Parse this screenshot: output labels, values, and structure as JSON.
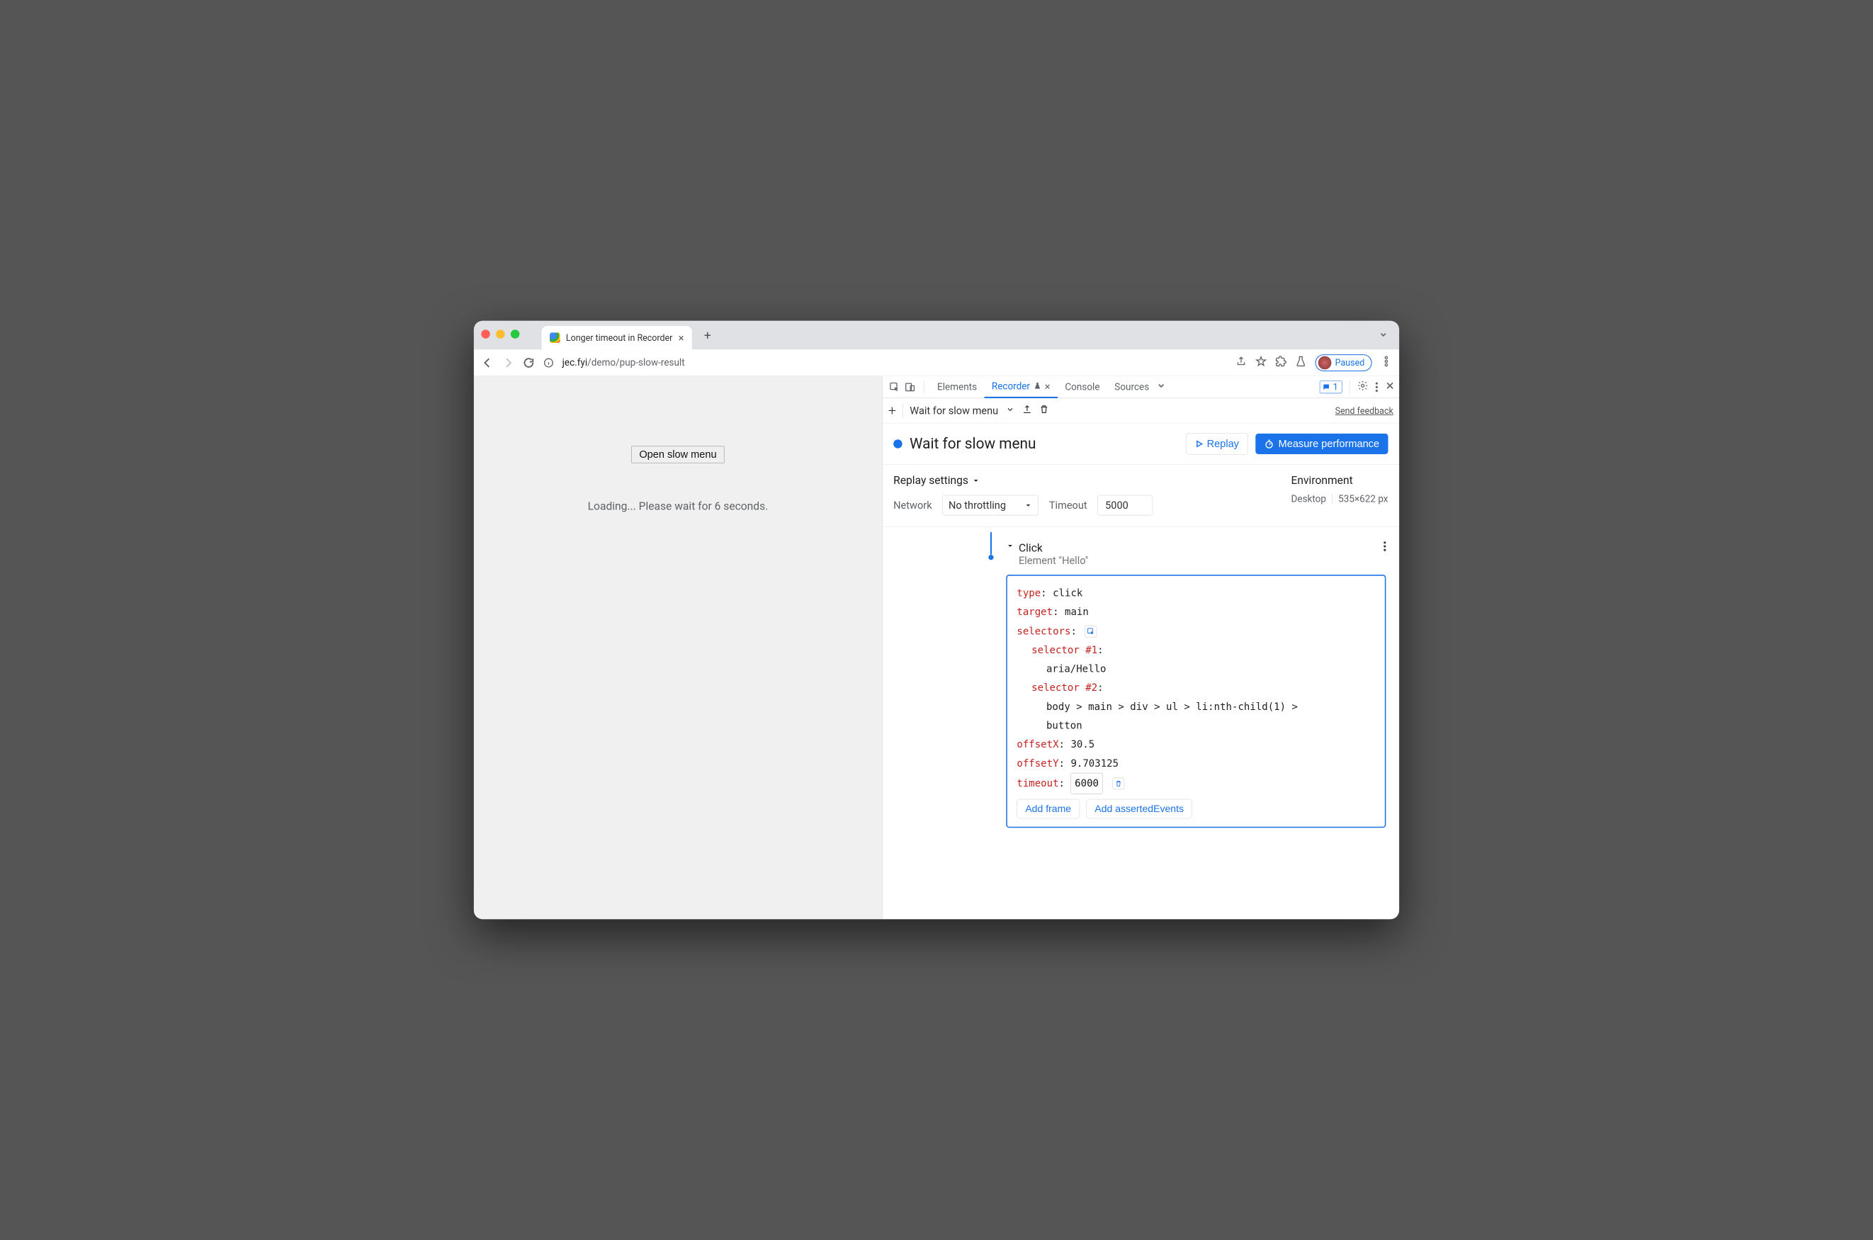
{
  "browser": {
    "tab_title": "Longer timeout in Recorder",
    "url_host": "jec.fyi",
    "url_path": "/demo/pup-slow-result",
    "paused_label": "Paused"
  },
  "page": {
    "button_label": "Open slow menu",
    "loading_text": "Loading... Please wait for 6 seconds."
  },
  "devtools": {
    "tabs": {
      "elements": "Elements",
      "recorder": "Recorder",
      "console": "Console",
      "sources": "Sources"
    },
    "issues_count": "1",
    "feedback": "Send feedback"
  },
  "recorder": {
    "toolbar_name": "Wait for slow menu",
    "title": "Wait for slow menu",
    "replay": "Replay",
    "measure": "Measure performance",
    "settings_title": "Replay settings",
    "network_label": "Network",
    "network_value": "No throttling",
    "timeout_label": "Timeout",
    "timeout_value": "5000",
    "env_title": "Environment",
    "env_device": "Desktop",
    "env_size": "535×622 px"
  },
  "step": {
    "title": "Click",
    "subtitle": "Element \"Hello\"",
    "type_key": "type",
    "type_val": ": click",
    "target_key": "target",
    "target_val": ": main",
    "selectors_key": "selectors",
    "selectors_colon": ":",
    "sel1_key": "selector #1",
    "sel1_colon": ":",
    "sel1_val": "aria/Hello",
    "sel2_key": "selector #2",
    "sel2_colon": ":",
    "sel2_val_a": "body > main > div > ul > li:nth-child(1) >",
    "sel2_val_b": "button",
    "offx_key": "offsetX",
    "offx_val": ": 30.5",
    "offy_key": "offsetY",
    "offy_val": ": 9.703125",
    "timeout_key": "timeout",
    "timeout_colon": ": ",
    "timeout_val": "6000",
    "add_frame": "Add frame",
    "add_asserted": "Add assertedEvents"
  }
}
